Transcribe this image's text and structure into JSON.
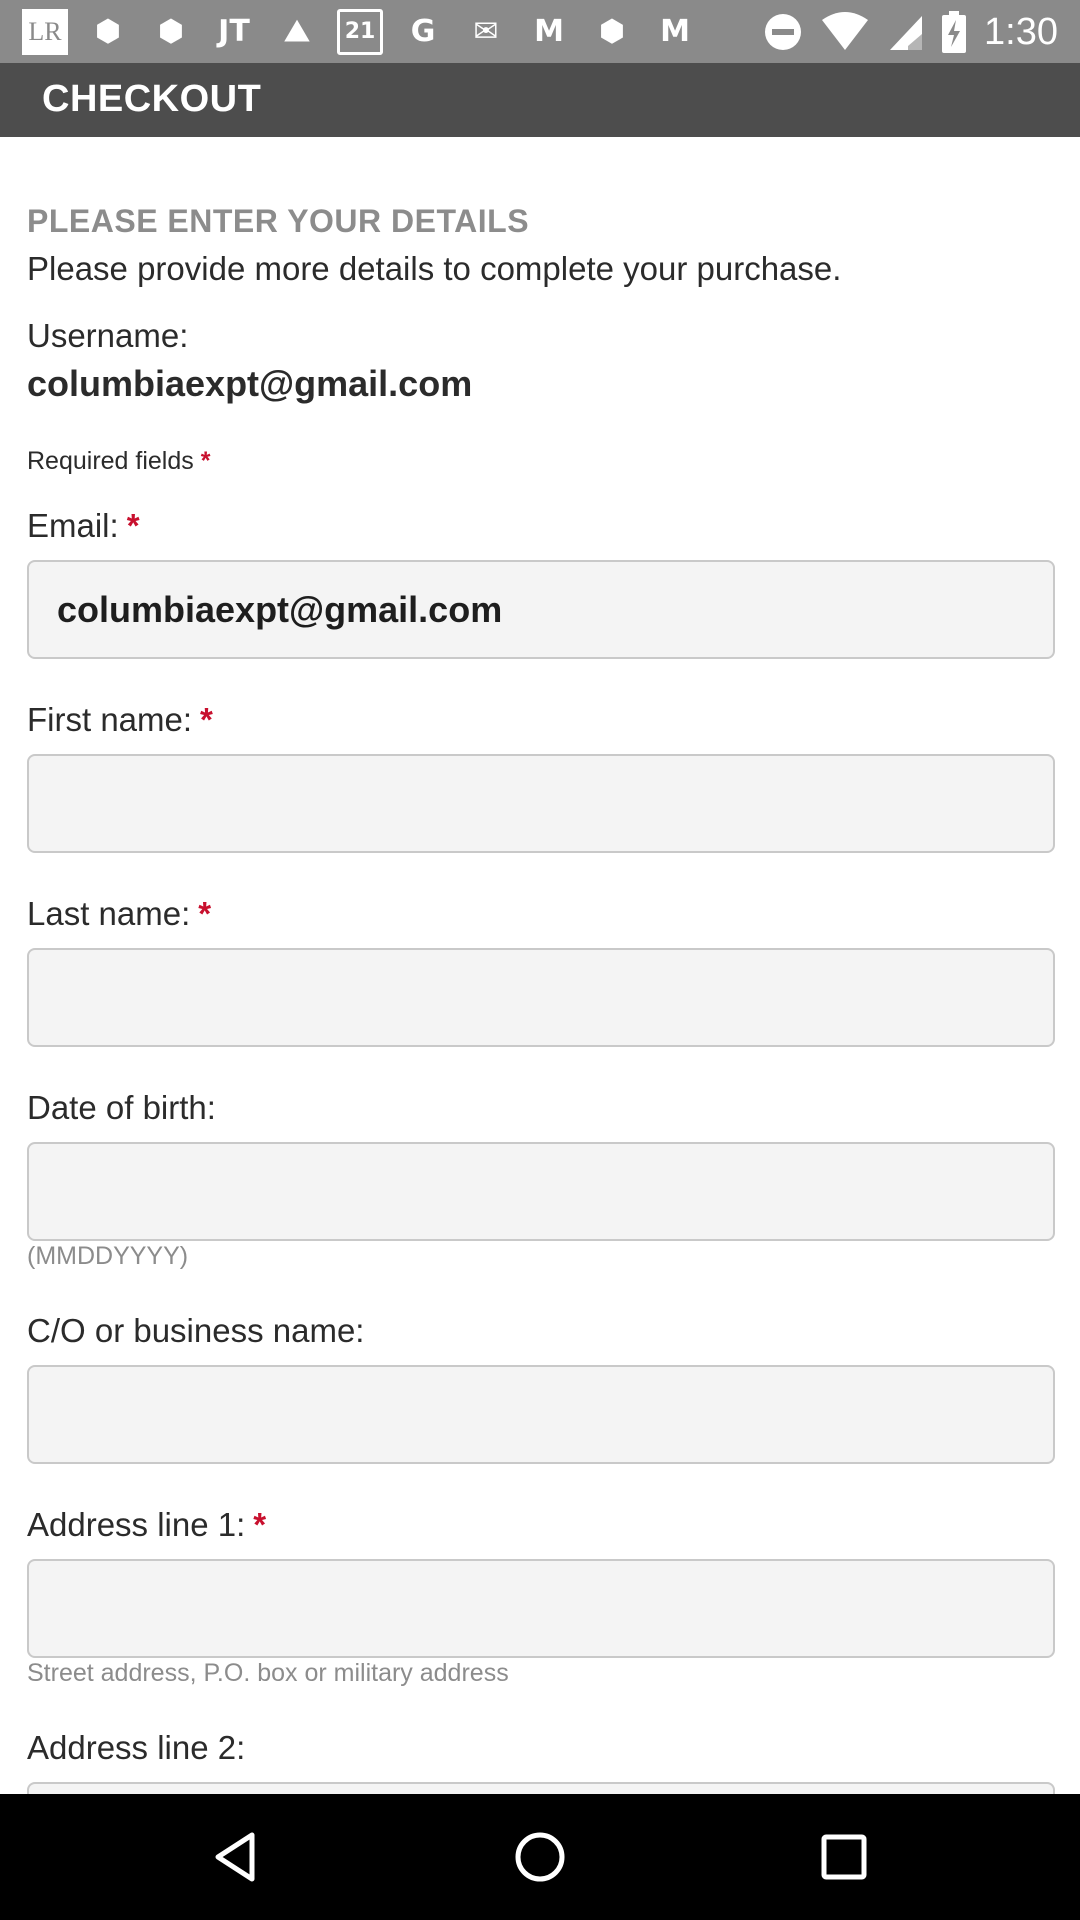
{
  "status_bar": {
    "time": "1:30",
    "notification_icons": [
      {
        "name": "lr-app-icon",
        "glyph": "LR"
      },
      {
        "name": "shopping-bag-icon",
        "glyph": "⬢"
      },
      {
        "name": "shopping-bag-icon-2",
        "glyph": "⬢"
      },
      {
        "name": "jt-app-icon",
        "glyph": "JT"
      },
      {
        "name": "outdoor-app-icon",
        "glyph": "⛰"
      },
      {
        "name": "forever21-app-icon",
        "glyph": "21"
      },
      {
        "name": "google-icon",
        "glyph": "G"
      },
      {
        "name": "gmail-icon",
        "glyph": "✉"
      },
      {
        "name": "m-app-icon",
        "glyph": "M"
      },
      {
        "name": "shopping-bag-icon-3",
        "glyph": "⬢"
      },
      {
        "name": "m-app-icon-2",
        "glyph": "M"
      }
    ]
  },
  "app_bar": {
    "title": "CHECKOUT"
  },
  "form": {
    "section_heading": "PLEASE ENTER YOUR DETAILS",
    "intro": "Please provide more details to complete your purchase.",
    "username_label": "Username:",
    "username_value": "columbiaexpt@gmail.com",
    "required_note": "Required fields",
    "required_marker": "*",
    "fields": {
      "email": {
        "label": "Email:",
        "value": "columbiaexpt@gmail.com",
        "required": true
      },
      "first_name": {
        "label": "First name:",
        "value": "",
        "required": true
      },
      "last_name": {
        "label": "Last name:",
        "value": "",
        "required": true
      },
      "dob": {
        "label": "Date of birth:",
        "value": "",
        "hint": "(MMDDYYYY)",
        "required": false
      },
      "co_business": {
        "label": "C/O or business name:",
        "value": "",
        "required": false
      },
      "address1": {
        "label": "Address line 1:",
        "value": "",
        "hint": "Street address, P.O. box or military address",
        "required": true
      },
      "address2": {
        "label": "Address line 2:",
        "value": "",
        "required": false
      }
    }
  },
  "colors": {
    "status_bar": "#8a8a8a",
    "app_bar": "#4d4d4d",
    "required_star": "#c8102e",
    "input_background": "#f4f4f4",
    "muted_text": "#8c8c8c"
  }
}
